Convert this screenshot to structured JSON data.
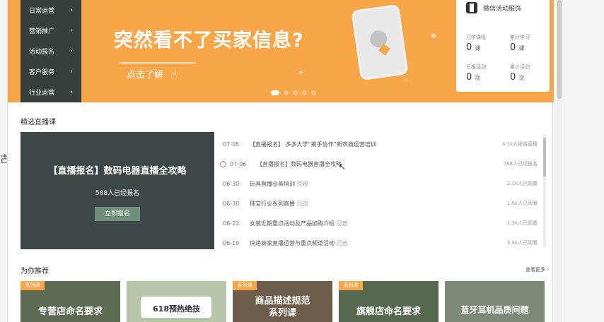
{
  "side_menu": [
    {
      "label": "日常运营"
    },
    {
      "label": "营销推广"
    },
    {
      "label": "活动报名"
    },
    {
      "label": "客户服务"
    },
    {
      "label": "行业运营"
    }
  ],
  "banner": {
    "headline": "突然看不了买家信息?",
    "cta": "点击了解",
    "accent": "#f7a64a"
  },
  "info_card": {
    "name": "微信活动服饰",
    "stats": [
      {
        "label": "已学课程",
        "value": "0",
        "unit": "课"
      },
      {
        "label": "累计学习",
        "value": "0",
        "unit": "课"
      },
      {
        "label": "已报活动",
        "value": "0",
        "unit": "次"
      },
      {
        "label": "累计活动",
        "value": "0",
        "unit": "次"
      }
    ]
  },
  "live_section": {
    "title": "精选直播课",
    "featured": {
      "title": "【直播报名】数码电器直播全攻略",
      "count": "588人已经报名",
      "button": "立即报名"
    },
    "items": [
      {
        "date": "07-05",
        "title": "【直播报名】 多多大学“携手协作”新农商运营培训",
        "tag": "",
        "count": "4.1k人报名直播"
      },
      {
        "date": "07-06",
        "title": "【直播报名】数码电器直播全攻略",
        "tag": "",
        "count": "588人已经报名"
      },
      {
        "date": "06-30",
        "title": "玩具直播业务培训",
        "tag": "回放",
        "count": "2.1k人已观看"
      },
      {
        "date": "06-30",
        "title": "珠宝行业系列直播",
        "tag": "回放",
        "count": "1.6k人已观看"
      },
      {
        "date": "06-23",
        "title": "女装近期重点活动及产品加购介绍",
        "tag": "回放",
        "count": "1.3k人已观看"
      },
      {
        "date": "06-19",
        "title": "快递商家直播运营与重点频道活动",
        "tag": "回放",
        "count": "3.4k人已观看"
      }
    ]
  },
  "recommend_section": {
    "title": "为你推荐",
    "more": "查看更多 ›",
    "cards": [
      {
        "badge": "系列课",
        "label": "专营店命名要求",
        "bg": "#5e6b52"
      },
      {
        "badge": "",
        "label": "618预热绝技",
        "bg": "#b7c5a8"
      },
      {
        "badge": "系列课",
        "label": "商品描述规范 系列课",
        "bg": "#6e5d4a"
      },
      {
        "badge": "系列课",
        "label": "旗舰店命名要求",
        "bg": "#57684e"
      },
      {
        "badge": "",
        "label": "蓝牙耳机品质问题",
        "bg": "#7d8a78"
      }
    ]
  }
}
